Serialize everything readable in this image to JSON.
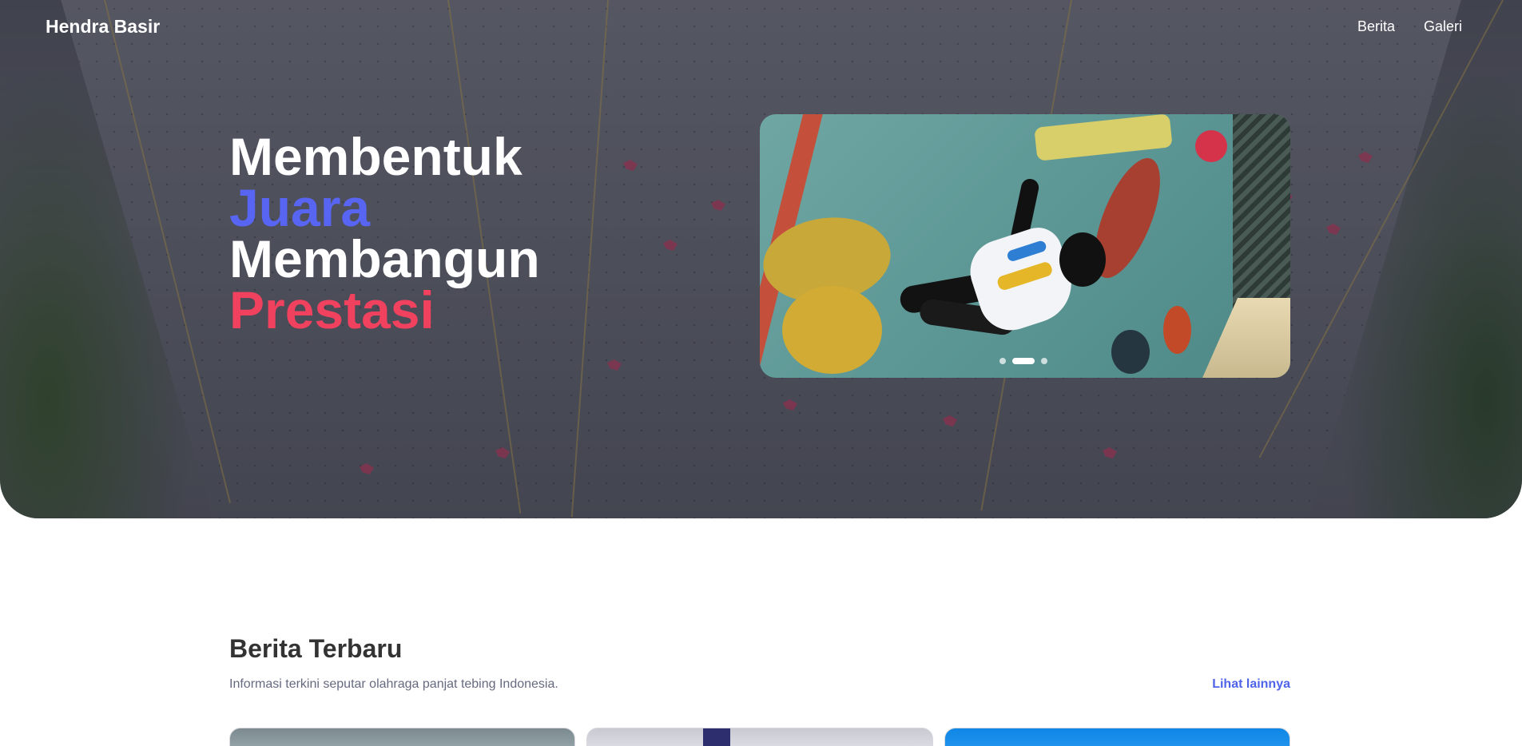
{
  "nav": {
    "brand": "Hendra Basir",
    "links": [
      "Berita",
      "Galeri"
    ]
  },
  "hero": {
    "headline": [
      "Membentuk",
      "Juara",
      "Membangun",
      "Prestasi"
    ],
    "carousel": {
      "slide_count": 3,
      "active_index": 1
    }
  },
  "news": {
    "title": "Berita Terbaru",
    "subtitle": "Informasi terkini seputar olahraga panjat tebing Indonesia.",
    "more_label": "Lihat lainnya"
  },
  "colors": {
    "accent_blue": "#5865f2",
    "accent_red": "#f0415e",
    "link_blue": "#4f63e8"
  }
}
